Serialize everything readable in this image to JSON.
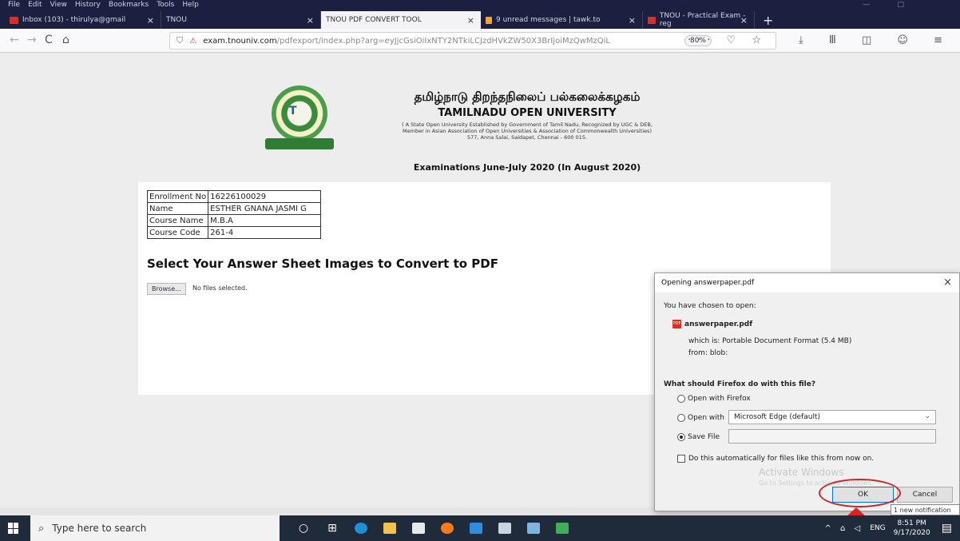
{
  "menubar": {
    "items": [
      "File",
      "Edit",
      "View",
      "History",
      "Bookmarks",
      "Tools",
      "Help"
    ]
  },
  "tabs": [
    {
      "label": "Inbox (103) - thirulya@gmail",
      "fav_color": "#d93025",
      "close": "×",
      "width": 196
    },
    {
      "label": "TNOU",
      "fav_color": "#1c1f3f",
      "close": "×",
      "width": 200
    },
    {
      "label": "TNOU PDF CONVERT TOOL",
      "fav_color": "#f3f3f5",
      "close": "×",
      "width": 200
    },
    {
      "label": "9 unread messages | tawk.to",
      "fav_color": "#f5a623",
      "close": "×",
      "width": 203
    },
    {
      "label": "TNOU - Practical Exam - reg",
      "fav_color": "#d93025",
      "close": "×",
      "width": 140
    }
  ],
  "nav": {
    "back": "←",
    "forward": "→",
    "reload": "C",
    "home": "⌂",
    "url_domain": "exam.tnouniv.com",
    "url_path": "/pdfexport/index.php?arg=eyJjcGsiOiIxNTY2NTkiLCJzdHVkZW50X3BrIjoiMzQwMzQiL",
    "zoom": "80%",
    "page_actions": "··· ♡ ☆",
    "right_icons": "⤓ Ⅲ ◫ ☺ ≡"
  },
  "page": {
    "tamil_name": "தமிழ்நாடு திறந்தநிலைப் பல்கலைக்கழகம்",
    "university": "TAMILNADU OPEN UNIVERSITY",
    "desc_line1": "( A State Open University Established by Government of Tamil Nadu, Recognized by UGC & DEB,",
    "desc_line2": "Member in Asian Association of Open Universities & Association of Commonwealth Universities)",
    "desc_line3": "577, Anna Salai, Saidapet, Chennai - 600 015.",
    "exam_title": "Examinations June-July 2020 (In August 2020)",
    "student": [
      {
        "label": "Enrollment No",
        "value": "16226100029"
      },
      {
        "label": "Name",
        "value": "ESTHER GNANA JASMI G"
      },
      {
        "label": "Course Name",
        "value": "M.B.A"
      },
      {
        "label": "Course Code",
        "value": "261-4"
      }
    ],
    "heading": "Select Your Answer Sheet Images to Convert to PDF",
    "browse": "Browse...",
    "no_files": "No files selected."
  },
  "dialog": {
    "title": "Opening answerpaper.pdf",
    "close": "×",
    "chosen": "You have chosen to open:",
    "file_name": "answerpaper.pdf",
    "which": "which is:  Portable Document Format (5.4 MB)",
    "from": "from:  blob:",
    "question": "What should Firefox do with this file?",
    "open_with_firefox": "Open with Firefox",
    "open_with": "Open with",
    "open_with_app": "Microsoft Edge (default)",
    "save_file": "Save File",
    "auto": "Do this automatically for files like this from now on.",
    "watermark": "Activate Windows",
    "watermark2": "Go to Settings to activate Windows.",
    "ok": "OK",
    "cancel": "Cancel"
  },
  "notification": "1 new notification",
  "taskbar": {
    "search_placeholder": "Type here to search",
    "time": "8:51 PM",
    "date": "9/17/2020",
    "lang": "ENG",
    "tray_icons": "^ ⌂ ◁"
  },
  "colors": {
    "highlight": "#c62828",
    "arrow": "#e02020",
    "titlebar": "#1c1f3f",
    "taskbar": "#1f2a3a"
  }
}
